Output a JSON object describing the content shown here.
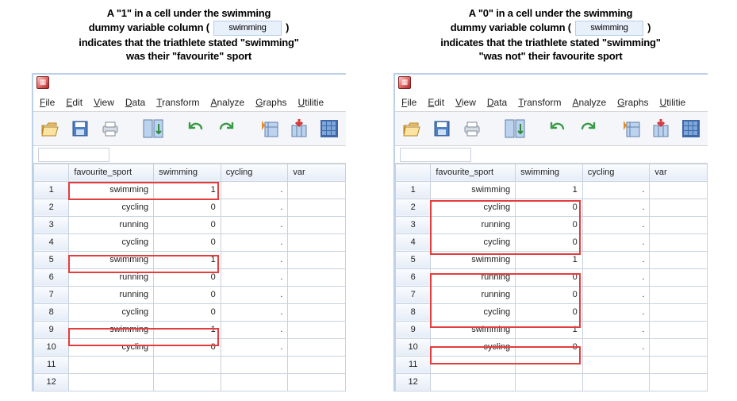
{
  "left": {
    "caption_l1_a": "A \"1\" in a cell under the swimming",
    "caption_l2_a": "dummy variable column (",
    "caption_l2_b": ")",
    "caption_l3": "indicates that the triathlete stated \"swimming\"",
    "caption_l4": "was their \"favourite\" sport",
    "inline_label": "swimming"
  },
  "right": {
    "caption_l1_a": "A \"0\" in a cell under the swimming",
    "caption_l2_a": "dummy variable column (",
    "caption_l2_b": ")",
    "caption_l3": "indicates that the triathlete stated \"swimming\"",
    "caption_l4": "\"was not\" their favourite sport",
    "inline_label": "swimming"
  },
  "menus": {
    "file": "File",
    "edit": "Edit",
    "view": "View",
    "data": "Data",
    "transform": "Transform",
    "analyze": "Analyze",
    "graphs": "Graphs",
    "utilities": "Utilitie"
  },
  "columns": {
    "c1": "favourite_sport",
    "c2": "swimming",
    "c3": "cycling",
    "c4": "var"
  },
  "rows": {
    "r1": "1",
    "r2": "2",
    "r3": "3",
    "r4": "4",
    "r5": "5",
    "r6": "6",
    "r7": "7",
    "r8": "8",
    "r9": "9",
    "r10": "10",
    "r11": "11",
    "r12": "12"
  },
  "data": {
    "fs1": "swimming",
    "sw1": "1",
    "fs2": "cycling",
    "sw2": "0",
    "fs3": "running",
    "sw3": "0",
    "fs4": "cycling",
    "sw4": "0",
    "fs5": "swimming",
    "sw5": "1",
    "fs6": "running",
    "sw6": "0",
    "fs7": "running",
    "sw7": "0",
    "fs8": "cycling",
    "sw8": "0",
    "fs9": "swimming",
    "sw9": "1",
    "fs10": "cycling",
    "sw10": "0"
  },
  "dot": "."
}
